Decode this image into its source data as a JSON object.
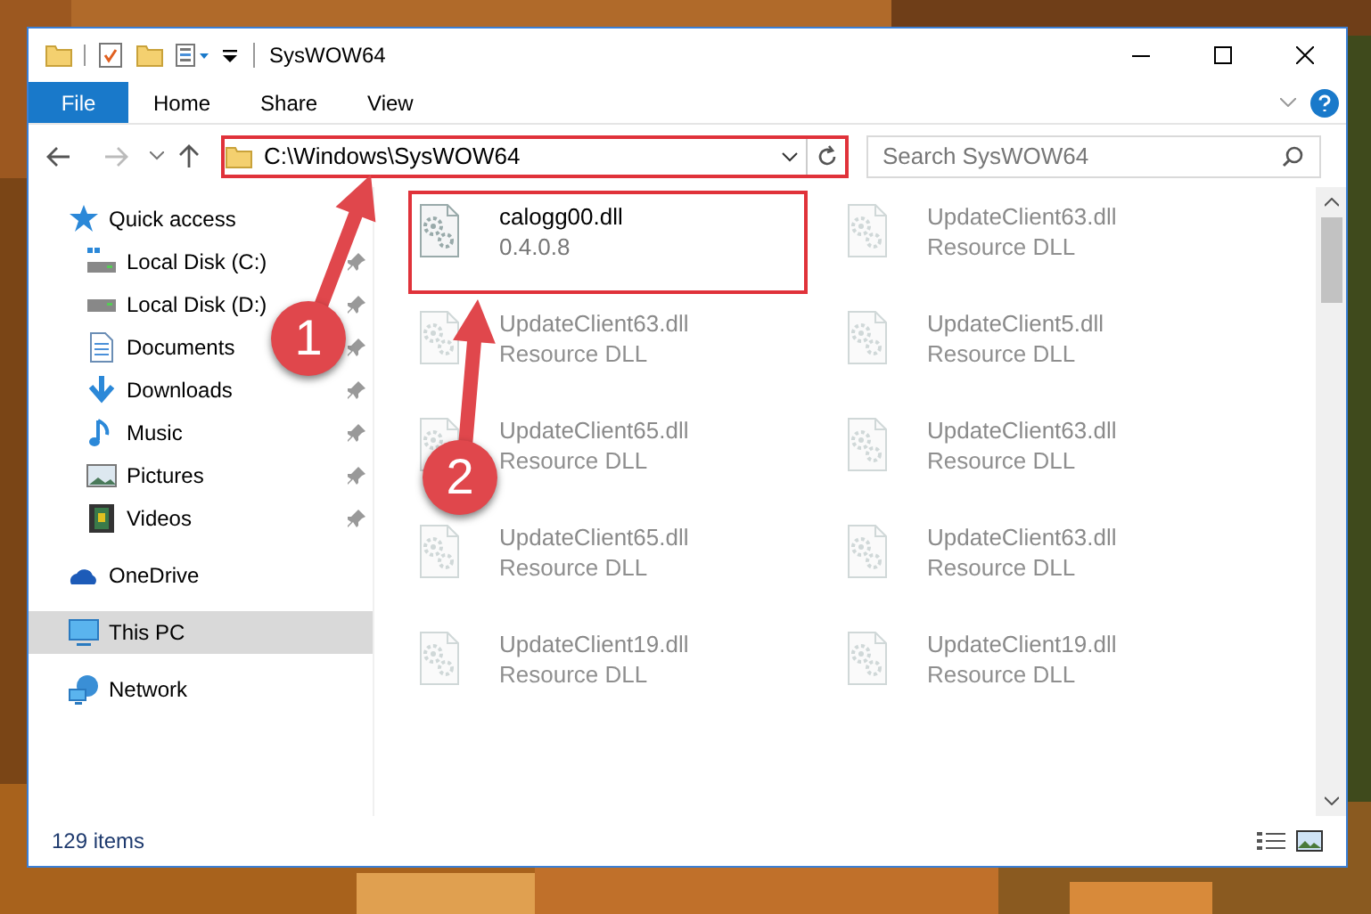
{
  "window": {
    "title": "SysWOW64"
  },
  "ribbon_tabs": [
    {
      "label": "File",
      "kind": "file",
      "selected": false
    },
    {
      "label": "Home",
      "kind": "tab",
      "selected": false
    },
    {
      "label": "Share",
      "kind": "tab",
      "selected": false
    },
    {
      "label": "View",
      "kind": "tab",
      "selected": false
    }
  ],
  "address": {
    "path": "C:\\Windows\\SysWOW64",
    "highlighted": true
  },
  "search": {
    "placeholder": "Search SysWOW64"
  },
  "sidebar": {
    "items": [
      {
        "label": "Quick access",
        "kind": "star",
        "pinned": false,
        "selected": false,
        "children": [
          {
            "label": "Local Disk (C:)",
            "kind": "drive-c",
            "pinned": true,
            "selected": false
          },
          {
            "label": "Local Disk (D:)",
            "kind": "drive",
            "pinned": true,
            "selected": false
          },
          {
            "label": "Documents",
            "kind": "doc",
            "pinned": true,
            "selected": false
          },
          {
            "label": "Downloads",
            "kind": "download",
            "pinned": true,
            "selected": false
          },
          {
            "label": "Music",
            "kind": "music",
            "pinned": true,
            "selected": false
          },
          {
            "label": "Pictures",
            "kind": "pictures",
            "pinned": true,
            "selected": false
          },
          {
            "label": "Videos",
            "kind": "videos",
            "pinned": true,
            "selected": false
          }
        ]
      },
      {
        "label": "OneDrive",
        "kind": "cloud",
        "pinned": false,
        "selected": false
      },
      {
        "label": "This PC",
        "kind": "pc",
        "pinned": false,
        "selected": true
      },
      {
        "label": "Network",
        "kind": "network",
        "pinned": false,
        "selected": false
      }
    ]
  },
  "files": [
    {
      "name": "calogg00.dll",
      "detail": "0.4.0.8",
      "blurred": false,
      "highlighted": true
    },
    {
      "name": "UpdateClient63.dll",
      "detail": "Resource DLL",
      "blurred": true,
      "highlighted": false
    },
    {
      "name": "UpdateClient63.dll",
      "detail": "Resource DLL",
      "blurred": true,
      "highlighted": false
    },
    {
      "name": "UpdateClient5.dll",
      "detail": "Resource DLL",
      "blurred": true,
      "highlighted": false
    },
    {
      "name": "UpdateClient65.dll",
      "detail": "Resource DLL",
      "blurred": true,
      "highlighted": false
    },
    {
      "name": "UpdateClient63.dll",
      "detail": "Resource DLL",
      "blurred": true,
      "highlighted": false
    },
    {
      "name": "UpdateClient65.dll",
      "detail": "Resource DLL",
      "blurred": true,
      "highlighted": false
    },
    {
      "name": "UpdateClient63.dll",
      "detail": "Resource DLL",
      "blurred": true,
      "highlighted": false
    },
    {
      "name": "UpdateClient19.dll",
      "detail": "Resource DLL",
      "blurred": true,
      "highlighted": false
    },
    {
      "name": "UpdateClient19.dll",
      "detail": "Resource DLL",
      "blurred": true,
      "highlighted": false
    }
  ],
  "status_bar": {
    "count": "129 items"
  },
  "annotations": [
    {
      "number": "1"
    },
    {
      "number": "2"
    }
  ]
}
